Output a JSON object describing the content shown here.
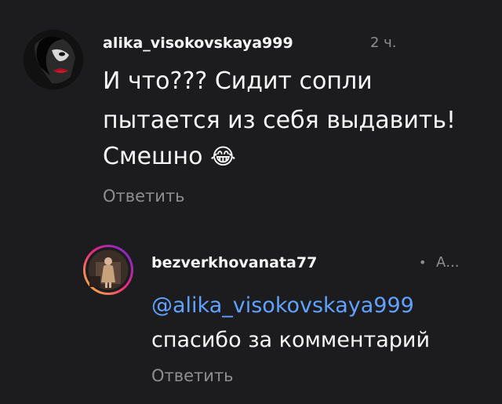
{
  "comments": [
    {
      "username": "alika_visokovskaya999",
      "time": "2 ч.",
      "lines": [
        "И что??? Сидит сопли",
        "пытается из себя выдавить!",
        "Смешно"
      ],
      "emoji": "😂",
      "reply_label": "Ответить"
    },
    {
      "username": "bezverkhovanata77",
      "meta_dot": "•",
      "meta_text": "А...",
      "mention": "@alika_visokovskaya999",
      "text": "спасибо за комментарий",
      "reply_label": "Ответить"
    }
  ],
  "colors": {
    "background": "#1c1c1e",
    "mention": "#5fa2ff",
    "secondary_text": "#8e8e93",
    "story_ring_start": "#f9ce34",
    "story_ring_mid": "#ee2a7b",
    "story_ring_end": "#6228d7"
  },
  "icons": {
    "emoji": "face-with-tears-of-joy"
  }
}
